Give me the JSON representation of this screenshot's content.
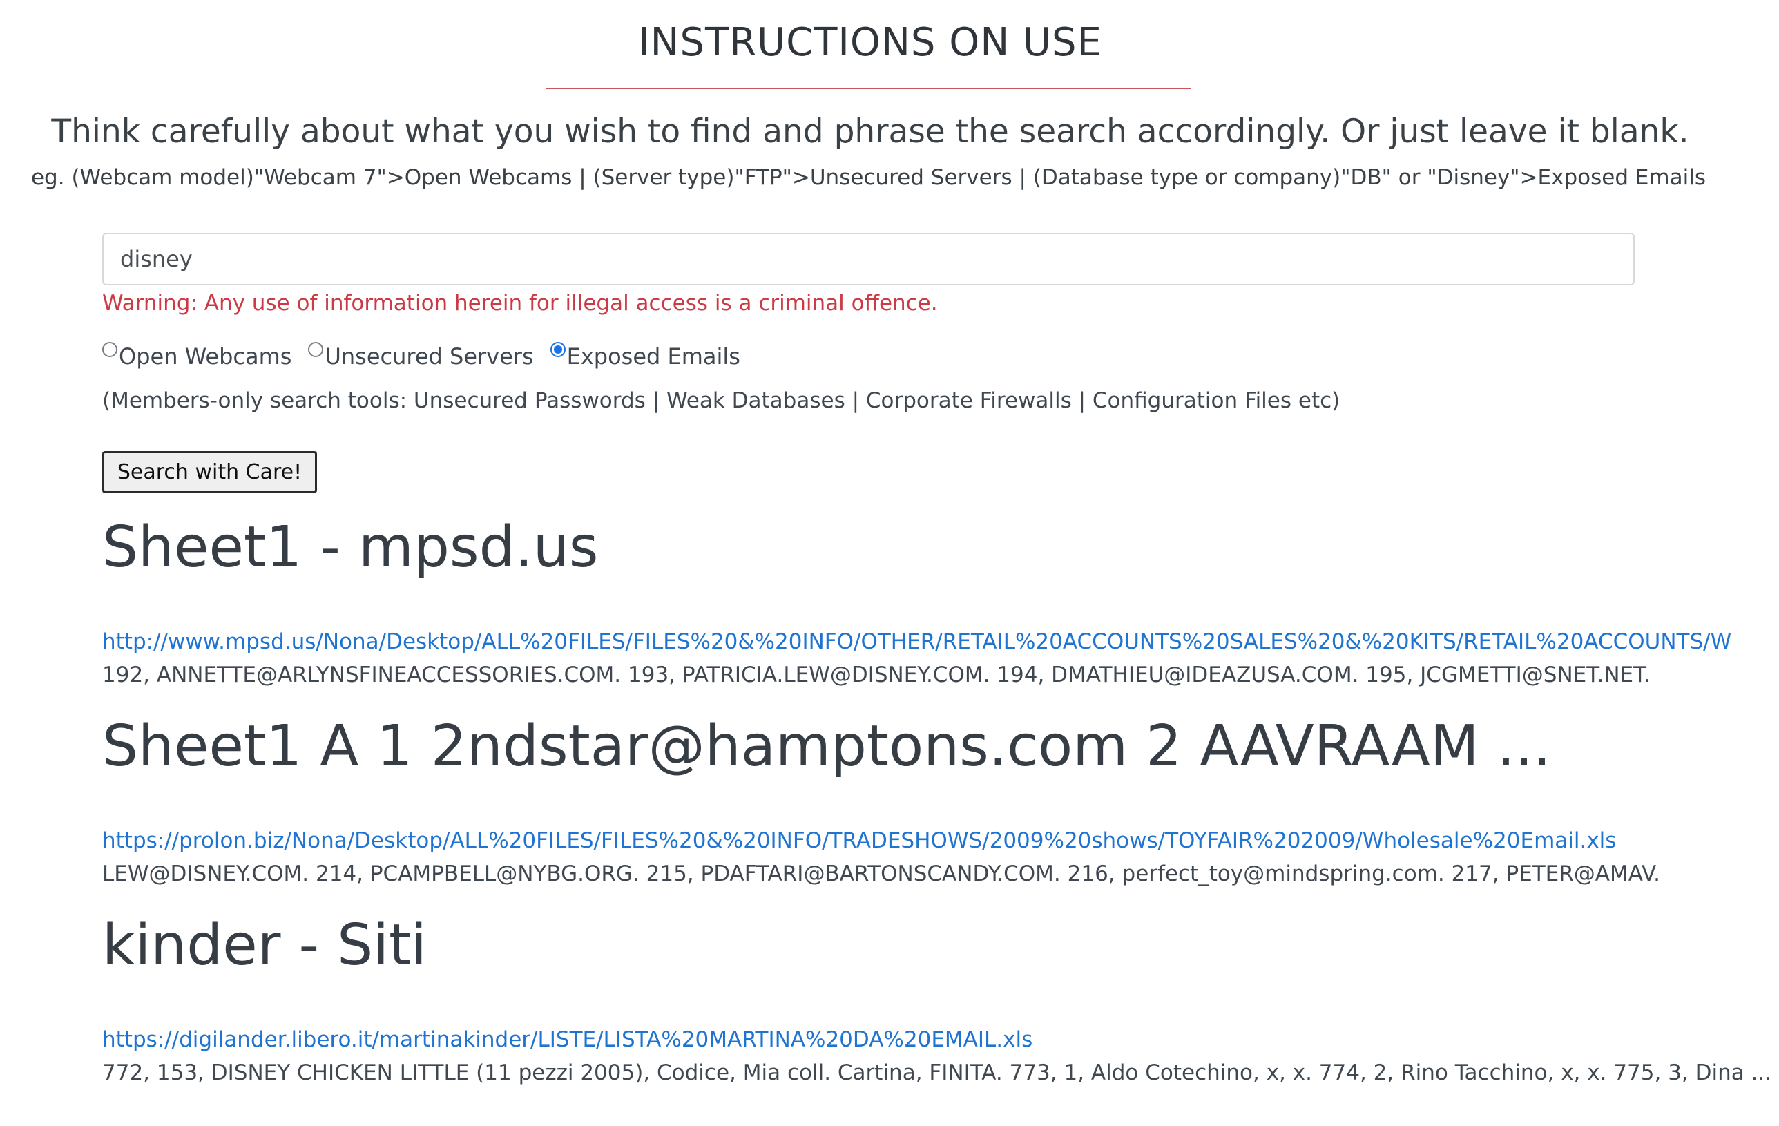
{
  "header": {
    "title": "INSTRUCTIONS ON USE",
    "lead": "Think carefully about what you wish to find and phrase the search accordingly. Or just leave it blank.",
    "example": "eg. (Webcam model)\"Webcam 7\">Open Webcams | (Server type)\"FTP\">Unsecured Servers | (Database type or company)\"DB\" or \"Disney\">Exposed Emails"
  },
  "search": {
    "value": "disney",
    "warning": "Warning: Any use of information herein for illegal access is a criminal offence.",
    "options": [
      {
        "label": "Open Webcams",
        "checked": false
      },
      {
        "label": "Unsecured Servers",
        "checked": false
      },
      {
        "label": "Exposed Emails",
        "checked": true
      }
    ],
    "members_note": "(Members-only search tools: Unsecured Passwords | Weak Databases | Corporate Firewalls | Configuration Files etc)",
    "button_label": "Search with Care!"
  },
  "results": [
    {
      "title": "Sheet1 - mpsd.us",
      "url": "http://www.mpsd.us/Nona/Desktop/ALL%20FILES/FILES%20&%20INFO/OTHER/RETAIL%20ACCOUNTS%20SALES%20&%20KITS/RETAIL%20ACCOUNTS/W",
      "snippet": "192, ANNETTE@ARLYNSFINEACCESSORIES.COM. 193, PATRICIA.LEW@DISNEY.COM. 194, DMATHIEU@IDEAZUSA.COM. 195, JCGMETTI@SNET.NET."
    },
    {
      "title": "Sheet1 A 1 2ndstar@hamptons.com 2 AAVRAAM ...",
      "url": "https://prolon.biz/Nona/Desktop/ALL%20FILES/FILES%20&%20INFO/TRADESHOWS/2009%20shows/TOYFAIR%202009/Wholesale%20Email.xls",
      "snippet": "LEW@DISNEY.COM. 214, PCAMPBELL@NYBG.ORG. 215, PDAFTARI@BARTONSCANDY.COM. 216, perfect_toy@mindspring.com. 217, PETER@AMAV."
    },
    {
      "title": "kinder - Siti",
      "url": "https://digilander.libero.it/martinakinder/LISTE/LISTA%20MARTINA%20DA%20EMAIL.xls",
      "snippet": "772, 153, DISNEY CHICKEN LITTLE (11 pezzi 2005), Codice, Mia coll. Cartina, FINITA. 773, 1, Aldo Cotechino, x, x. 774, 2, Rino Tacchino, x, x. 775, 3, Dina ..."
    }
  ]
}
